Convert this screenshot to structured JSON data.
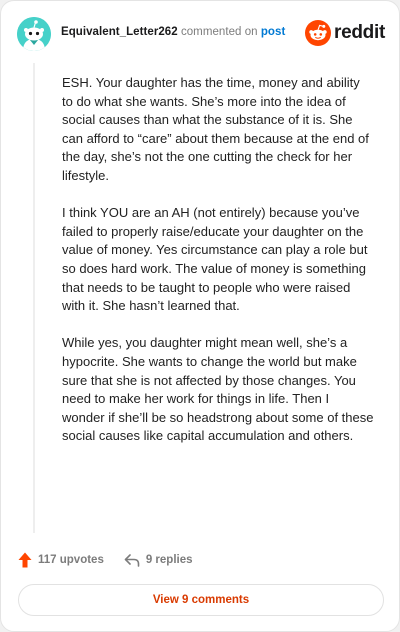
{
  "comment": {
    "username": "Equivalent_Letter262",
    "action_text": "commented on",
    "post_link": "post",
    "paragraphs": [
      "ESH. Your daughter has the time, money and ability to do what she wants. She’s more into the idea of social causes than what the substance of it is. She can afford to “care” about them because at the end of the day, she’s not the one cutting the check for her lifestyle.",
      "I think YOU are an AH (not entirely) because you’ve failed to properly raise/educate your daughter on the value of money. Yes circumstance can play a role but so does hard work. The value of money is something that needs to be taught to people who were raised with it. She hasn’t learned that.",
      "While yes, you daughter might mean well, she’s a hypocrite. She wants to change the world but make sure that she is not affected by those changes. You need to make her work for things in life. Then I wonder if she’ll be so headstrong about some of these social causes like capital accumulation and others."
    ]
  },
  "brand": {
    "wordmark": "reddit",
    "color": "#ff4500"
  },
  "actions": {
    "upvotes": "117 upvotes",
    "replies": "9 replies"
  },
  "view_button": {
    "label": "View 9 comments"
  },
  "colors": {
    "avatar_bg": "#46d1c9",
    "link": "#0079d3",
    "accent": "#ff4500",
    "view_label": "#d93a00"
  },
  "icons": {
    "avatar": "snoo-avatar-icon",
    "brand": "reddit-logo-icon",
    "upvote": "upvote-arrow-icon",
    "reply": "reply-arrow-icon"
  }
}
